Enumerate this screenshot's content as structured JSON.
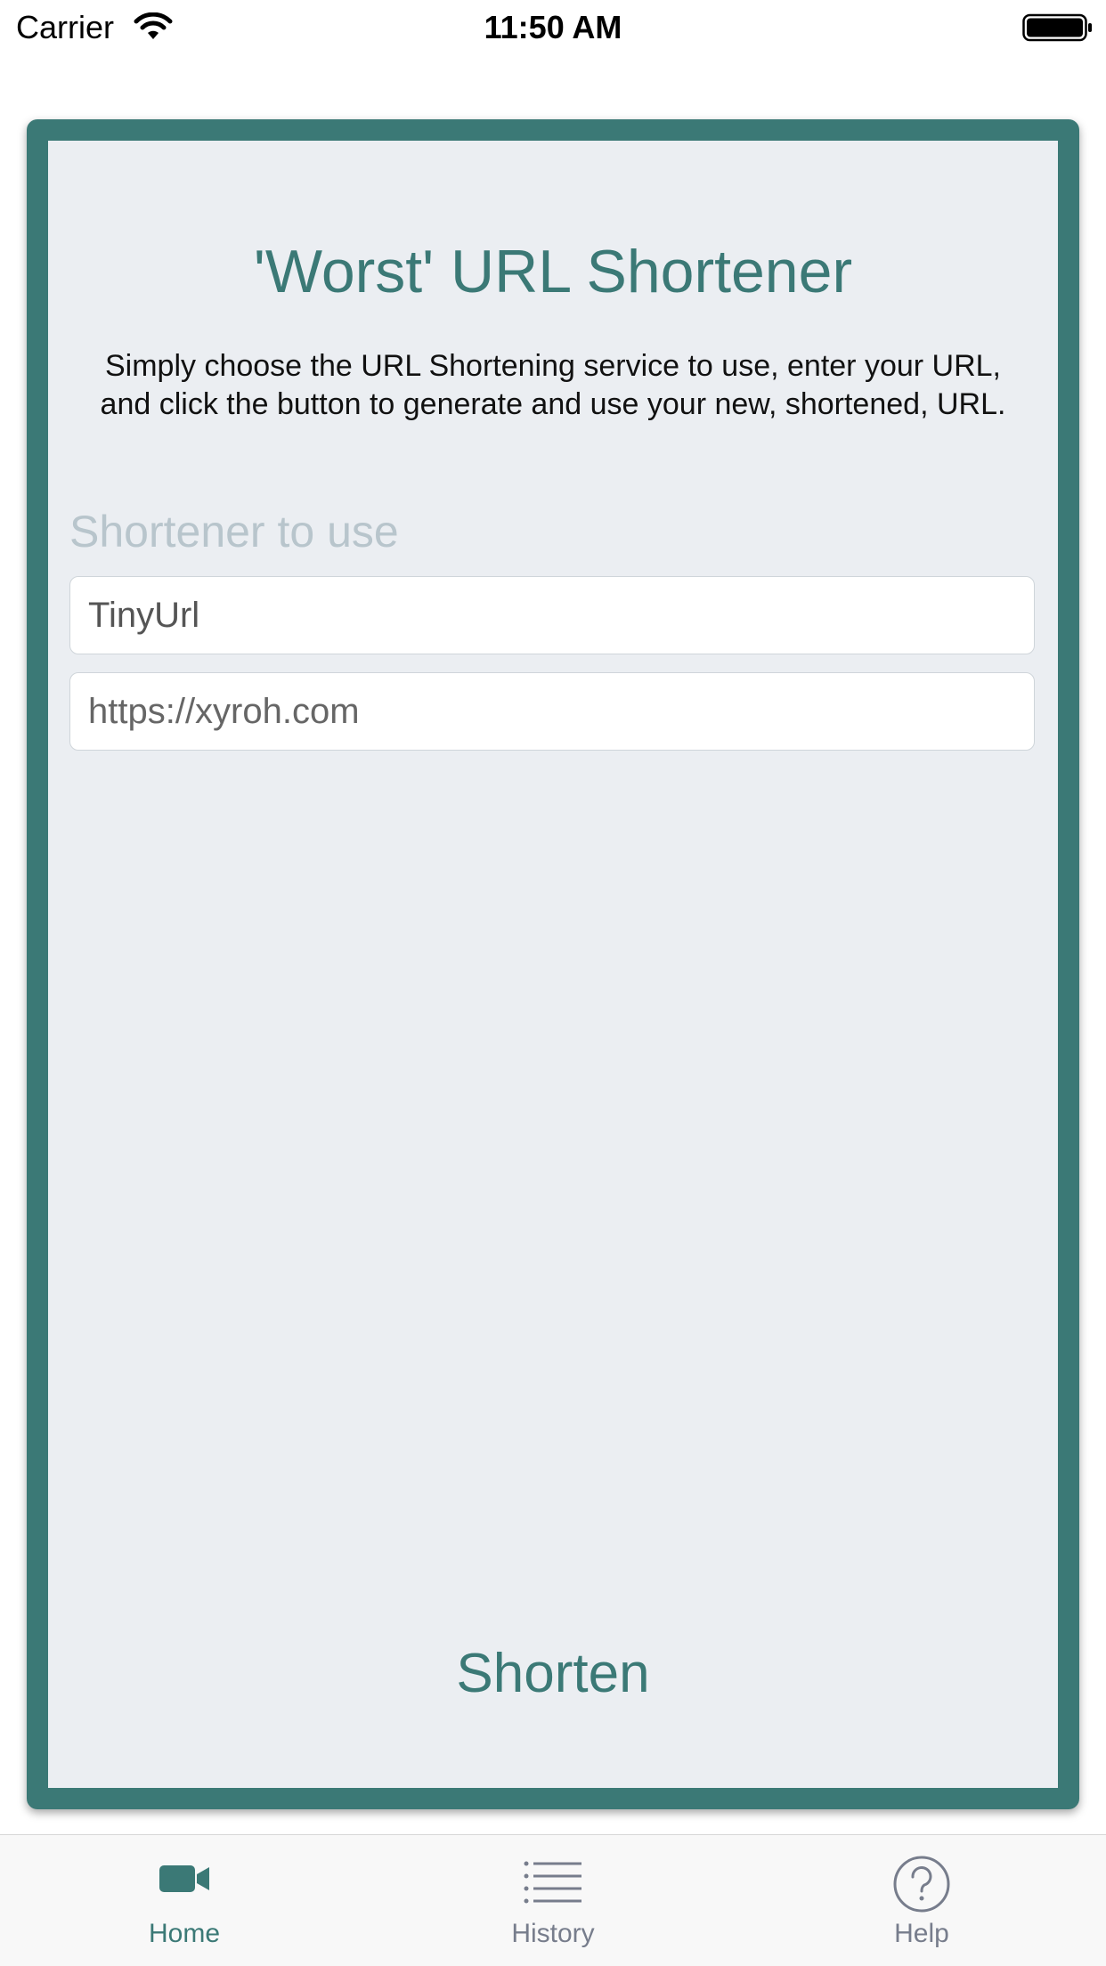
{
  "status_bar": {
    "carrier": "Carrier",
    "time": "11:50 AM"
  },
  "main": {
    "title": "'Worst' URL Shortener",
    "description": "Simply choose the URL Shortening service to use, enter your URL, and click the button to generate and use your new, shortened, URL.",
    "shortener_label": "Shortener to use",
    "shortener_value": "TinyUrl",
    "url_placeholder": "https://xyroh.com",
    "shorten_button": "Shorten"
  },
  "tab_bar": {
    "home": "Home",
    "history": "History",
    "help": "Help"
  },
  "colors": {
    "accent": "#3b7976",
    "card_background": "#ebeef2",
    "inactive_tab": "#777d8c"
  }
}
